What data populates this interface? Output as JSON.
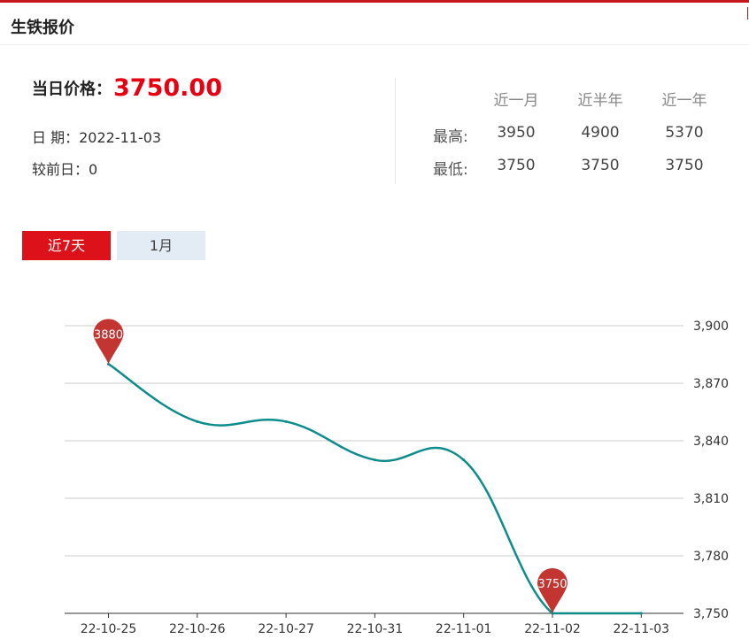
{
  "header": {
    "title": "生铁报价"
  },
  "price": {
    "label": "当日价格：",
    "value": "3750.00"
  },
  "info": {
    "date_label": "日 期：",
    "date_value": "2022-11-03",
    "change_label": "较前日：",
    "change_value": "0"
  },
  "stats": {
    "columns": [
      "近一月",
      "近半年",
      "近一年"
    ],
    "rows": [
      {
        "label": "最高:",
        "values": [
          "3950",
          "4900",
          "5370"
        ]
      },
      {
        "label": "最低:",
        "values": [
          "3750",
          "3750",
          "3750"
        ]
      }
    ]
  },
  "tabs": [
    {
      "label": "近7天",
      "active": true
    },
    {
      "label": "1月",
      "active": false
    }
  ],
  "colors": {
    "accent": "#dc1119",
    "price": "#e60012",
    "line": "#0e8c8c",
    "pin": "#c23531"
  },
  "chart_data": {
    "type": "line",
    "categories": [
      "22-10-25",
      "22-10-26",
      "22-10-27",
      "22-10-31",
      "22-11-01",
      "22-11-02",
      "22-11-03"
    ],
    "values": [
      3880,
      3850,
      3850,
      3830,
      3830,
      3750,
      3750
    ],
    "ylim": [
      3750,
      3900
    ],
    "yticks": [
      "3,750",
      "3,780",
      "3,810",
      "3,840",
      "3,870",
      "3,900"
    ],
    "ytick_values": [
      3750,
      3780,
      3810,
      3840,
      3870,
      3900
    ],
    "y_axis_side": "right",
    "grid": true,
    "markers": [
      {
        "label": "3880",
        "category": "22-10-25",
        "value": 3880
      },
      {
        "label": "3750",
        "category": "22-11-02",
        "value": 3750
      }
    ]
  }
}
